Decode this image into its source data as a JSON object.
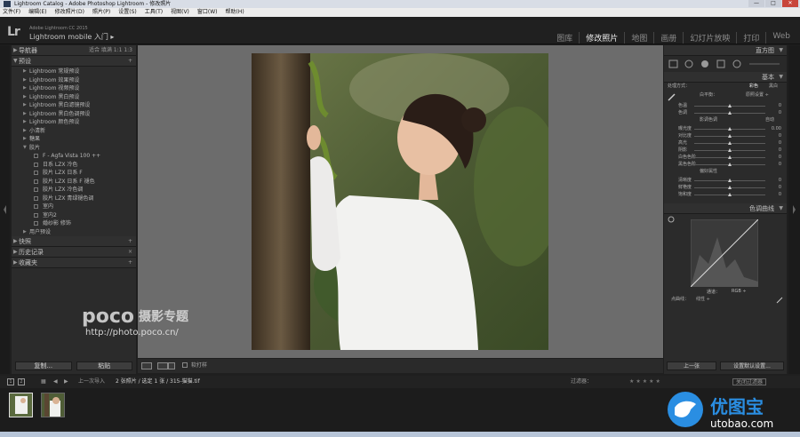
{
  "window": {
    "title": "Lightroom Catalog - Adobe Photoshop Lightroom - 修改照片",
    "controls": [
      "—",
      "□",
      "✕"
    ]
  },
  "menubar": [
    "文件(F)",
    "编辑(E)",
    "修改照片(D)",
    "照片(P)",
    "设置(S)",
    "工具(T)",
    "视图(V)",
    "窗口(W)",
    "帮助(H)"
  ],
  "header": {
    "logo": "Lr",
    "product": "Adobe Lightroom CC 2015",
    "mobile_label": "Lightroom mobile 入门 ▸",
    "modules": [
      "图库",
      "修改照片",
      "地图",
      "画册",
      "幻灯片放映",
      "打印",
      "Web"
    ],
    "active_module": "修改照片"
  },
  "left_panel": {
    "navigator": {
      "title": "导航器",
      "options": "适合  填满  1:1  1:3"
    },
    "presets": {
      "title": "预设",
      "add": "+",
      "items": [
        {
          "label": "Lightroom 常规预设",
          "level": 0
        },
        {
          "label": "Lightroom 效果预设",
          "level": 0
        },
        {
          "label": "Lightroom 视频预设",
          "level": 0
        },
        {
          "label": "Lightroom 黑白预设",
          "level": 0
        },
        {
          "label": "Lightroom 黑白滤镜预设",
          "level": 0
        },
        {
          "label": "Lightroom 黑白色调预设",
          "level": 0
        },
        {
          "label": "Lightroom 颜色预设",
          "level": 0
        },
        {
          "label": "小清新",
          "level": 0
        },
        {
          "label": "糖果",
          "level": 0
        },
        {
          "label": "胶片",
          "level": 0,
          "open": true
        },
        {
          "label": "F - Agfa Vista 100 ++",
          "level": 1
        },
        {
          "label": "日系 LZX 冷色",
          "level": 1
        },
        {
          "label": "胶片 LZX 日系 F",
          "level": 1
        },
        {
          "label": "胶片 LZX 日系 F 褪色",
          "level": 1
        },
        {
          "label": "胶片 LZX 冷色调",
          "level": 1
        },
        {
          "label": "胶片 LZX 青绿褪色调",
          "level": 1
        },
        {
          "label": "室内",
          "level": 1
        },
        {
          "label": "室内2",
          "level": 1
        },
        {
          "label": "婚纱影 修饰",
          "level": 1
        },
        {
          "label": "用户预设",
          "level": 0
        }
      ]
    },
    "snapshots": {
      "title": "快照",
      "add": "+"
    },
    "history": {
      "title": "历史记录",
      "clear": "×"
    },
    "collections": {
      "title": "收藏夹",
      "add": "+"
    },
    "copy_button": "复制...",
    "paste_button": "粘贴"
  },
  "toolbar": {
    "softproof": "软打样"
  },
  "watermark": {
    "brand": "poco",
    "cn": "摄影专题",
    "url": "http://photo.poco.cn/"
  },
  "right_panel": {
    "histogram_title": "直方图",
    "basic_title": "基本",
    "treatment_label": "处理方式：",
    "treatment_options": [
      "彩色",
      "黑白"
    ],
    "wb_label": "白平衡：",
    "wb_value": "原照设置 ÷",
    "wb_sliders": [
      {
        "label": "色温",
        "value": "0",
        "pos": 0.5
      },
      {
        "label": "色调",
        "value": "0",
        "pos": 0.5
      }
    ],
    "tone_label": "影调色调",
    "auto_label": "自动",
    "tone_sliders": [
      {
        "label": "曝光度",
        "value": "0.00",
        "pos": 0.5
      },
      {
        "label": "对比度",
        "value": "0",
        "pos": 0.5
      },
      {
        "label": "高光",
        "value": "0",
        "pos": 0.5
      },
      {
        "label": "阴影",
        "value": "0",
        "pos": 0.5
      },
      {
        "label": "白色色阶",
        "value": "0",
        "pos": 0.5
      },
      {
        "label": "黑色色阶",
        "value": "0",
        "pos": 0.5
      }
    ],
    "presence_label": "偏好属性",
    "presence_sliders": [
      {
        "label": "清晰度",
        "value": "0",
        "pos": 0.5
      },
      {
        "label": "鲜艳度",
        "value": "0",
        "pos": 0.5
      },
      {
        "label": "饱和度",
        "value": "0",
        "pos": 0.5
      }
    ],
    "tone_curve_title": "色调曲线",
    "channel_label": "通道：",
    "channel_value": "RGB ÷",
    "point_curve_label": "点曲线：",
    "point_curve_value": "线性 ÷",
    "prev_button": "上一张",
    "reset_button": "设置默认设置..."
  },
  "filmstrip": {
    "pages": [
      "1",
      "2"
    ],
    "source": "上一次导入",
    "count": "2 张照片 / 选定 1 张 / 315-猫猫.tif",
    "filter_label": "过滤器：",
    "filter_value": "关闭过滤器"
  },
  "logo_watermark": {
    "brand": "优图宝",
    "domain": "utobao.com"
  }
}
